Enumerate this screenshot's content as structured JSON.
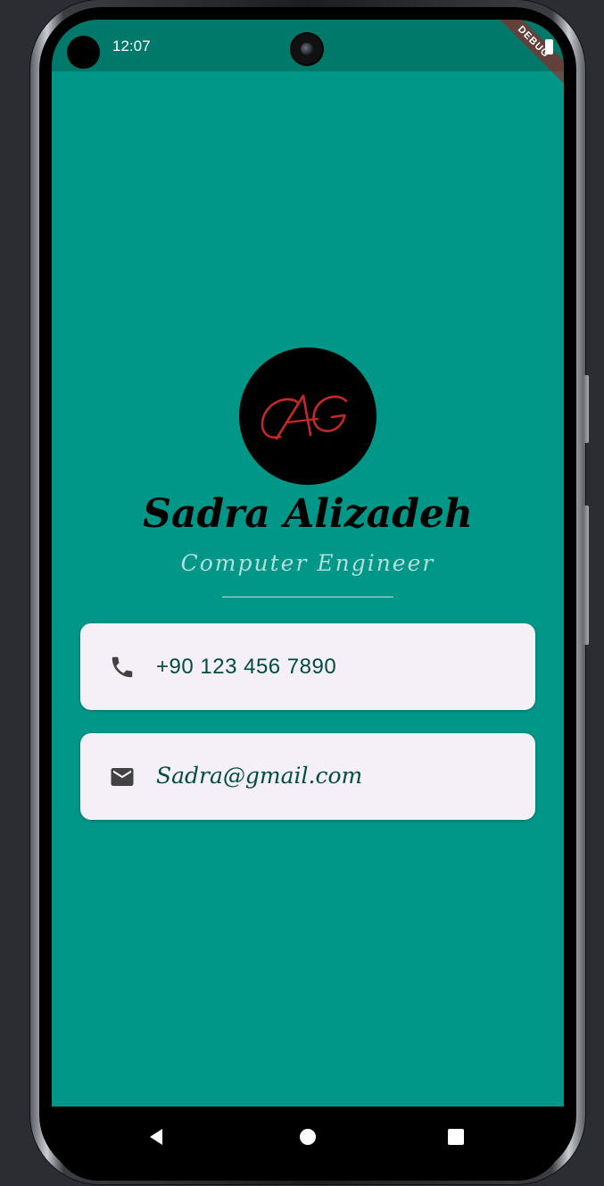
{
  "status_bar": {
    "time": "12:07",
    "debug_label": "DEBUG"
  },
  "profile": {
    "avatar_monogram": "CAG",
    "name": "Sadra Alizadeh",
    "title": "Computer Engineer"
  },
  "contacts": [
    {
      "icon": "phone-icon",
      "value": "+90 123 456 7890"
    },
    {
      "icon": "email-icon",
      "value": "Sadra@gmail.com"
    }
  ],
  "navigation": {
    "buttons": [
      "back-icon",
      "home-icon",
      "recents-icon"
    ]
  },
  "colors": {
    "status_bar": "#00796b",
    "background": "#009688",
    "card": "#f5eff7",
    "card_text": "#004d40",
    "subtitle": "#b2dfdb",
    "monogram": "#c62828"
  }
}
